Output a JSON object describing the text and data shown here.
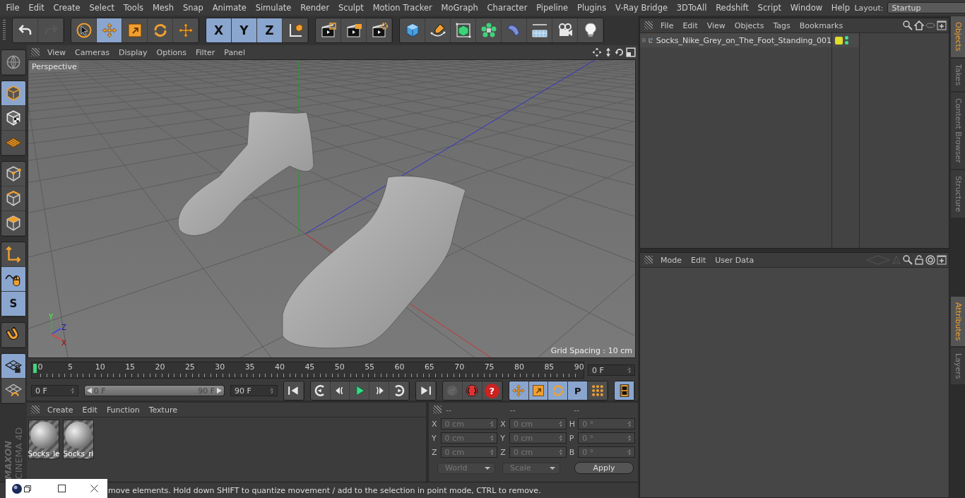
{
  "menu_bar": {
    "items": [
      "File",
      "Edit",
      "Create",
      "Select",
      "Tools",
      "Mesh",
      "Snap",
      "Animate",
      "Simulate",
      "Render",
      "Sculpt",
      "Motion Tracker",
      "MoGraph",
      "Character",
      "Pipeline",
      "Plugins",
      "V-Ray Bridge",
      "3DToAll",
      "Redshift",
      "Script",
      "Window",
      "Help"
    ],
    "layout_label": "Layout:",
    "layout_value": "Startup"
  },
  "toolbar": {
    "groups": [
      [
        {
          "kind": "undo",
          "selected": false,
          "disabled": false
        },
        {
          "kind": "redo",
          "selected": false,
          "disabled": true
        }
      ],
      [
        {
          "kind": "select",
          "selected": false,
          "disabled": false
        },
        {
          "kind": "move",
          "selected": true,
          "disabled": false
        },
        {
          "kind": "scale",
          "selected": false,
          "disabled": false
        },
        {
          "kind": "rotate",
          "selected": false,
          "disabled": false
        },
        {
          "kind": "transform",
          "selected": false,
          "disabled": false
        }
      ],
      [
        {
          "kind": "axis_letter",
          "label": "X",
          "selected": true,
          "disabled": false
        },
        {
          "kind": "axis_letter",
          "label": "Y",
          "selected": true,
          "disabled": false
        },
        {
          "kind": "axis_letter",
          "label": "Z",
          "selected": true,
          "disabled": false
        },
        {
          "kind": "coord",
          "selected": false,
          "disabled": false
        }
      ],
      [
        {
          "kind": "render_view",
          "selected": false,
          "disabled": false
        },
        {
          "kind": "render_picture",
          "selected": false,
          "disabled": false
        },
        {
          "kind": "render_settings",
          "selected": false,
          "disabled": false
        }
      ],
      [
        {
          "kind": "cube",
          "selected": false,
          "disabled": false
        },
        {
          "kind": "pen",
          "selected": false,
          "disabled": false
        },
        {
          "kind": "subdiv",
          "selected": false,
          "disabled": false
        },
        {
          "kind": "cloner",
          "selected": false,
          "disabled": false
        },
        {
          "kind": "deformer",
          "selected": false,
          "disabled": false
        },
        {
          "kind": "floor",
          "selected": false,
          "disabled": false
        },
        {
          "kind": "camera",
          "selected": false,
          "disabled": false
        },
        {
          "kind": "light",
          "selected": false,
          "disabled": false
        }
      ]
    ]
  },
  "left_toolbar": {
    "groups": [
      [
        {
          "kind": "globe",
          "selected": false
        }
      ],
      [
        {
          "kind": "model",
          "selected": true
        },
        {
          "kind": "texture",
          "selected": false
        },
        {
          "kind": "workplane",
          "selected": false
        }
      ],
      [
        {
          "kind": "points",
          "selected": false
        },
        {
          "kind": "edges",
          "selected": false
        },
        {
          "kind": "polygons",
          "selected": false
        }
      ],
      [
        {
          "kind": "axis",
          "selected": false
        },
        {
          "kind": "tweak",
          "selected": true
        },
        {
          "kind": "snap",
          "label": "S",
          "selected": true
        }
      ],
      [
        {
          "kind": "magnet",
          "selected": false
        }
      ],
      [
        {
          "kind": "lock_grid",
          "selected": true
        },
        {
          "kind": "grid_rotate",
          "selected": false
        }
      ]
    ]
  },
  "logo": [
    "MAXON",
    "CINEMA 4D"
  ],
  "viewport": {
    "menu": [
      "View",
      "Cameras",
      "Display",
      "Options",
      "Filter",
      "Panel"
    ],
    "camera_label": "Perspective",
    "grid_spacing": "Grid Spacing : 10 cm",
    "axis_labels": [
      "Y",
      "Z",
      "X"
    ]
  },
  "timeline": {
    "ticks": [
      "0",
      "5",
      "10",
      "15",
      "20",
      "25",
      "30",
      "35",
      "40",
      "45",
      "50",
      "55",
      "60",
      "65",
      "70",
      "75",
      "80",
      "85",
      "90"
    ],
    "current_frame": "0 F"
  },
  "transport": {
    "start": "0 F",
    "range_slider": {
      "start": "0 F",
      "end": "90 F",
      "level": 1
    },
    "end": "90 F",
    "groups": [
      [
        {
          "kind": "first",
          "selected": false,
          "disabled": false
        }
      ],
      [
        {
          "kind": "prev_key",
          "selected": false,
          "disabled": false
        },
        {
          "kind": "prev",
          "selected": false,
          "disabled": false
        },
        {
          "kind": "play",
          "selected": false,
          "disabled": false
        },
        {
          "kind": "next",
          "selected": false,
          "disabled": false
        },
        {
          "kind": "next_key",
          "selected": false,
          "disabled": false
        }
      ],
      [
        {
          "kind": "last",
          "selected": false,
          "disabled": false
        }
      ],
      [
        {
          "kind": "key",
          "selected": false,
          "disabled": true
        },
        {
          "kind": "record",
          "selected": false,
          "disabled": false
        },
        {
          "kind": "help",
          "label": "?",
          "selected": false,
          "disabled": false
        }
      ],
      [
        {
          "kind": "anim_move",
          "selected": true,
          "disabled": false
        },
        {
          "kind": "anim_scale",
          "selected": true,
          "disabled": false
        },
        {
          "kind": "anim_rotate",
          "selected": true,
          "disabled": false
        },
        {
          "kind": "anim_param",
          "label": "P",
          "selected": true,
          "disabled": false
        },
        {
          "kind": "anim_dots",
          "selected": false,
          "disabled": false
        }
      ],
      [
        {
          "kind": "film",
          "selected": true,
          "disabled": false
        }
      ]
    ]
  },
  "material_manager": {
    "menu": [
      "Create",
      "Edit",
      "Function",
      "Texture"
    ],
    "materials": [
      {
        "name": "Socks_le"
      },
      {
        "name": "Socks_ri"
      }
    ]
  },
  "coordinates": {
    "headers": [
      "--",
      "--",
      "--"
    ],
    "rows": [
      [
        {
          "label": "X",
          "value": "0 cm"
        },
        {
          "label": "X",
          "value": "0 cm"
        },
        {
          "label": "H",
          "value": "0 °"
        }
      ],
      [
        {
          "label": "Y",
          "value": "0 cm"
        },
        {
          "label": "Y",
          "value": "0 cm"
        },
        {
          "label": "P",
          "value": "0 °"
        }
      ],
      [
        {
          "label": "Z",
          "value": "0 cm"
        },
        {
          "label": "Z",
          "value": "0 cm"
        },
        {
          "label": "B",
          "value": "0 °"
        }
      ]
    ],
    "dropdowns": [
      "World",
      "Scale"
    ],
    "apply": "Apply"
  },
  "status_bar": {
    "text": "move elements. Hold down SHIFT to quantize movement / add to the selection in point mode, CTRL to remove."
  },
  "object_manager": {
    "menu": [
      "File",
      "Edit",
      "View",
      "Objects",
      "Tags",
      "Bookmarks"
    ],
    "objects": [
      {
        "name": "Socks_Nike_Grey_on_The_Foot_Standing_001"
      }
    ]
  },
  "attributes": {
    "menu": [
      "Mode",
      "Edit",
      "User Data"
    ]
  },
  "side_tabs_top": [
    {
      "label": "Objects",
      "selected": true
    },
    {
      "label": "Takes",
      "selected": false
    },
    {
      "label": "Content Browser",
      "selected": false
    },
    {
      "label": "Structure",
      "selected": false
    }
  ],
  "side_tabs_bottom": [
    {
      "label": "Attributes",
      "selected": true
    },
    {
      "label": "Layers",
      "selected": false
    }
  ]
}
